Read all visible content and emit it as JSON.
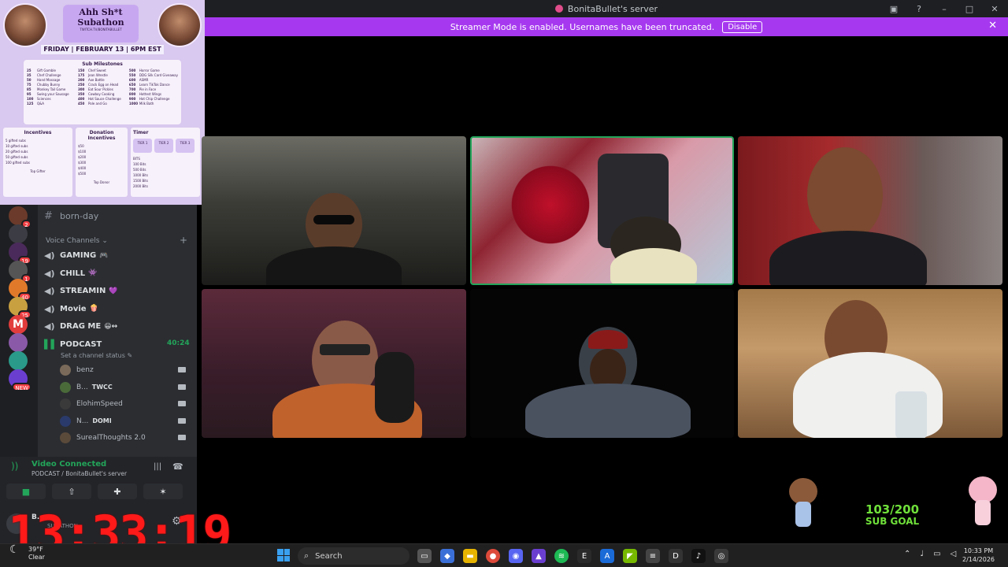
{
  "window": {
    "title": "BonitaBullet's server"
  },
  "banner": {
    "text": "Streamer Mode is enabled. Usernames have been truncated.",
    "disable_label": "Disable"
  },
  "poster": {
    "title_line1": "Ahh Sh*t",
    "title_line2": "Subathon",
    "social": "TWITCH.TV/BONITABULLET",
    "date": "FRIDAY | FEBRUARY 13 | 6PM EST",
    "milestones_title": "Sub Milestones",
    "milestones": [
      [
        "25",
        "Gift Gamble"
      ],
      [
        "35",
        "Chef Challenge"
      ],
      [
        "50",
        "Hand Massage"
      ],
      [
        "75",
        "Chubby Bunny"
      ],
      [
        "85",
        "Monkey Tail Game"
      ],
      [
        "95",
        "Swing your Sausage"
      ],
      [
        "100",
        "Sciences"
      ],
      [
        "125",
        "Q&A"
      ],
      [
        "150",
        "Chef Sweet"
      ],
      [
        "175",
        "Jean Wrestle"
      ],
      [
        "200",
        "Axe Battle"
      ],
      [
        "250",
        "Crack Egg on Head"
      ],
      [
        "300",
        "Eat Sour Pickles"
      ],
      [
        "350",
        "Cowboy Cooking"
      ],
      [
        "400",
        "Hot Sauce Challenge"
      ],
      [
        "450",
        "Pole and Go"
      ],
      [
        "500",
        "Horror Game"
      ],
      [
        "550",
        "DDG Silk Card Giveaway"
      ],
      [
        "600",
        "ASMR"
      ],
      [
        "650",
        "Learn TikTok Dance"
      ],
      [
        "700",
        "Pie in Face"
      ],
      [
        "800",
        "Hottest Wings"
      ],
      [
        "900",
        "Hot Chip Challenge"
      ],
      [
        "1000",
        "Milk Bath"
      ]
    ],
    "incentives_title": "Incentives",
    "incentives": [
      "5 gifted subs",
      "10 gifted subs",
      "20 gifted subs",
      "50 gifted subs",
      "100 gifted subs"
    ],
    "incentives_footer": "Top Gifter",
    "donation_title": "Donation Incentives",
    "donations": [
      "$50",
      "$100",
      "$200",
      "$300",
      "$400",
      "$500"
    ],
    "donation_footer": "Top Donor",
    "timer_title": "Timer",
    "timer_tiers": [
      "TIER 1",
      "TIER 2",
      "TIER 3"
    ],
    "timer_bits": [
      "BITS",
      "100 Bits",
      "500 Bits",
      "1000 Bits",
      "1500 Bits",
      "2000 Bits"
    ]
  },
  "rail": {
    "servers": [
      {
        "badge": "2"
      },
      {
        "badge": ""
      },
      {
        "badge": "19"
      },
      {
        "badge": "1"
      },
      {
        "badge": "40"
      },
      {
        "badge": "25"
      },
      {
        "badge": "",
        "label": "M"
      },
      {
        "badge": ""
      },
      {
        "badge": ""
      },
      {
        "badge": "NEW"
      }
    ]
  },
  "channels": {
    "text_channel": "born-day",
    "voice_category": "Voice Channels",
    "voice": [
      {
        "name": "GAMING",
        "emoji": "🎮"
      },
      {
        "name": "CHILL",
        "emoji": "👾"
      },
      {
        "name": "STREAMIN",
        "emoji": "💜"
      },
      {
        "name": "Movie",
        "emoji": "🍿"
      },
      {
        "name": "DRAG ME",
        "emoji": "😀↔"
      }
    ],
    "podcast": {
      "name": "PODCAST",
      "timer": "40:24",
      "set_status": "Set a channel status"
    },
    "users": [
      {
        "name": "benz",
        "tag": ""
      },
      {
        "name": "B...",
        "tag": "TWCC"
      },
      {
        "name": "ElohimSpeed",
        "tag": ""
      },
      {
        "name": "N...",
        "tag": "DOMI"
      },
      {
        "name": "SurealThoughts 2.0",
        "tag": ""
      }
    ]
  },
  "voice_panel": {
    "status": "Video Connected",
    "location": "PODCAST / BonitaBullet's server"
  },
  "user_bar": {
    "name": "B...",
    "sub": "SUBATHON"
  },
  "overlay": {
    "clock": "13:33:19",
    "subgoal_count": "103/200",
    "subgoal_label": "SUB GOAL"
  },
  "taskbar": {
    "weather_temp": "39°F",
    "weather_desc": "Clear",
    "search_label": "Search",
    "time": "10:33 PM",
    "date": "2/14/2026"
  }
}
